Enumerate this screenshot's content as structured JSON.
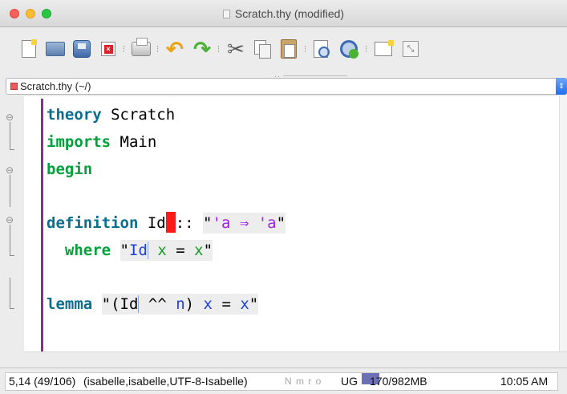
{
  "window": {
    "title": "Scratch.thy (modified)"
  },
  "toolbar": {
    "buttons": [
      {
        "name": "new-file",
        "icon": "new-file-icon"
      },
      {
        "name": "open-file",
        "icon": "folder-icon"
      },
      {
        "name": "save",
        "icon": "save-icon"
      },
      {
        "name": "close-buffer",
        "icon": "close-buffer-icon"
      },
      {
        "name": "print",
        "icon": "print-icon"
      },
      {
        "name": "undo",
        "icon": "undo-icon"
      },
      {
        "name": "redo",
        "icon": "redo-icon"
      },
      {
        "name": "cut",
        "icon": "scissors-icon"
      },
      {
        "name": "copy",
        "icon": "copy-icon"
      },
      {
        "name": "paste",
        "icon": "paste-icon"
      },
      {
        "name": "find",
        "icon": "find-icon"
      },
      {
        "name": "find-replace",
        "icon": "find-replace-icon"
      },
      {
        "name": "new-view",
        "icon": "new-view-icon"
      },
      {
        "name": "unsplit",
        "icon": "maximize-icon"
      }
    ],
    "grip": "··"
  },
  "buffer": {
    "label": "Scratch.thy (~/)",
    "arrow": "⌃⌄"
  },
  "code": {
    "line1_kw": "theory",
    "line1_name": " Scratch",
    "line2_kw": "imports",
    "line2_name": " Main",
    "line3_kw": "begin",
    "line5_kw": "definition",
    "line5_name": " Id",
    "line5_rest": ":: ",
    "line5_q1": "\"",
    "line5_tfree1": "'a",
    "line5_arrow": " ⇒ ",
    "line5_tfree2": "'a",
    "line5_q2": "\"",
    "line6_kw": "where",
    "line6_q1": "\"",
    "line6_id": "Id",
    "line6_x1": " x",
    "line6_eq": " = ",
    "line6_x2": "x",
    "line6_q2": "\"",
    "line8_kw": "lemma",
    "line8_q1": "\"(",
    "line8_id": "Id",
    "line8_pow": " ^^ ",
    "line8_n": "n",
    "line8_rest": ") ",
    "line8_x1": "x",
    "line8_eq": " = ",
    "line8_x2": "x",
    "line8_q2": "\""
  },
  "status": {
    "position": "5,14 (49/106)",
    "mode": "(isabelle,isabelle,UTF-8-Isabelle)",
    "flags": "N m r o",
    "ug": "UG",
    "memory": "170/982MB",
    "time": "10:05 AM"
  },
  "colors": {
    "outer_keyword": "#0a6e8f",
    "inner_keyword": "#02a13b",
    "type_variable": "#a020f0",
    "fixed_variable": "#1d3fd9",
    "error_cursor": "#ff1a1a",
    "theory_bar": "#8b2e8a"
  }
}
